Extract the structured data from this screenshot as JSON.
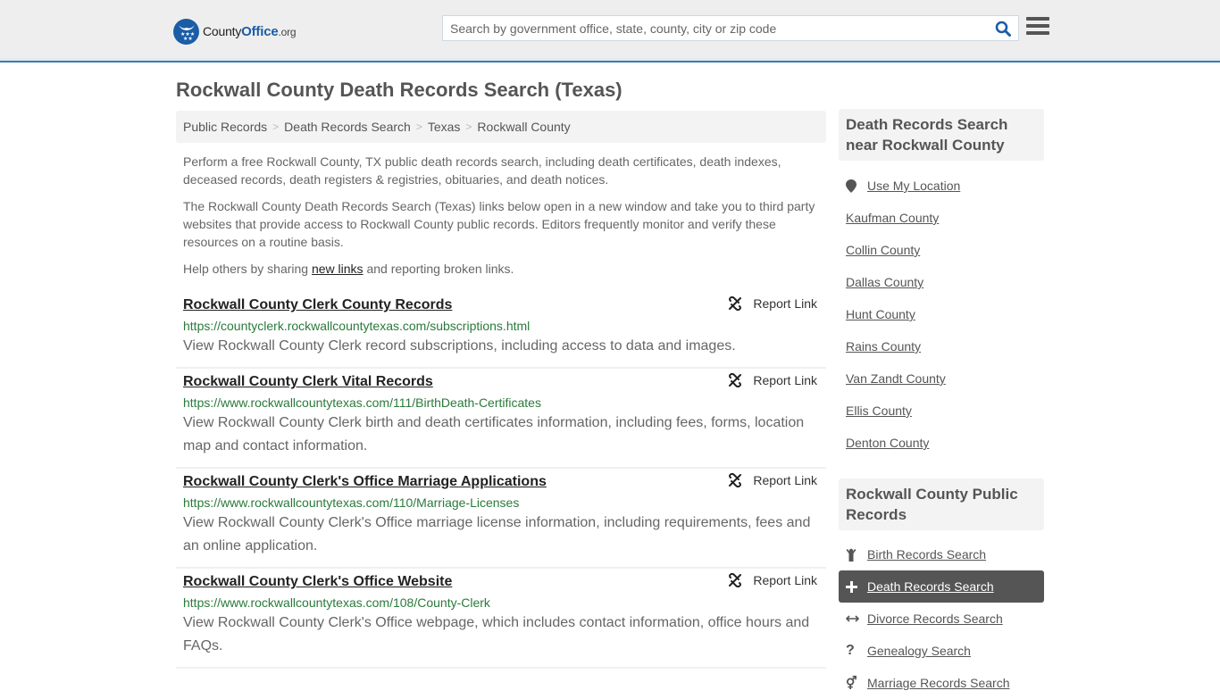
{
  "header": {
    "logo": {
      "brand_part1": "County",
      "brand_part2": "Office",
      "brand_tld": ".org",
      "icon": "eagle-stars-badge-icon"
    },
    "search": {
      "placeholder": "Search by government office, state, county, city or zip code",
      "value": "",
      "button_icon": "search-icon"
    },
    "menu_icon": "hamburger-menu-icon"
  },
  "colors": {
    "brand_blue": "#1a5da6",
    "header_bg": "#eeeeee",
    "header_border": "#3a7aad",
    "url_green": "#2a7a3a",
    "active_item_bg": "#555555"
  },
  "page": {
    "title": "Rockwall County Death Records Search (Texas)",
    "breadcrumb": [
      {
        "label": "Public Records"
      },
      {
        "label": "Death Records Search"
      },
      {
        "label": "Texas"
      },
      {
        "label": "Rockwall County"
      }
    ],
    "intro": {
      "p1": "Perform a free Rockwall County, TX public death records search, including death certificates, death indexes, deceased records, death registers & registries, obituaries, and death notices.",
      "p2": "The Rockwall County Death Records Search (Texas) links below open in a new window and take you to third party websites that provide access to Rockwall County public records. Editors frequently monitor and verify these resources on a routine basis.",
      "p3_before": "Help others by sharing ",
      "p3_link": "new links",
      "p3_after": " and reporting broken links."
    },
    "report_label": "Report Link",
    "results": [
      {
        "title": "Rockwall County Clerk County Records",
        "url": "https://countyclerk.rockwallcountytexas.com/subscriptions.html",
        "description": "View Rockwall County Clerk record subscriptions, including access to data and images."
      },
      {
        "title": "Rockwall County Clerk Vital Records",
        "url": "https://www.rockwallcountytexas.com/111/BirthDeath-Certificates",
        "description": "View Rockwall County Clerk birth and death certificates information, including fees, forms, location map and contact information."
      },
      {
        "title": "Rockwall County Clerk's Office Marriage Applications",
        "url": "https://www.rockwallcountytexas.com/110/Marriage-Licenses",
        "description": "View Rockwall County Clerk's Office marriage license information, including requirements, fees and an online application."
      },
      {
        "title": "Rockwall County Clerk's Office Website",
        "url": "https://www.rockwallcountytexas.com/108/County-Clerk",
        "description": "View Rockwall County Clerk's Office webpage, which includes contact information, office hours and FAQs."
      }
    ]
  },
  "sidebar": {
    "nearby": {
      "heading": "Death Records Search near Rockwall County",
      "use_location": "Use My Location",
      "counties": [
        "Kaufman County",
        "Collin County",
        "Dallas County",
        "Hunt County",
        "Rains County",
        "Van Zandt County",
        "Ellis County",
        "Denton County"
      ]
    },
    "public_records": {
      "heading": "Rockwall County Public Records",
      "items": [
        {
          "label": "Birth Records Search",
          "icon": "child-icon",
          "active": false
        },
        {
          "label": "Death Records Search",
          "icon": "plus-cross-icon",
          "active": true
        },
        {
          "label": "Divorce Records Search",
          "icon": "double-arrow-icon",
          "active": false
        },
        {
          "label": "Genealogy Search",
          "icon": "question-mark-icon",
          "active": false
        },
        {
          "label": "Marriage Records Search",
          "icon": "gender-symbol-icon",
          "active": false
        }
      ]
    }
  }
}
